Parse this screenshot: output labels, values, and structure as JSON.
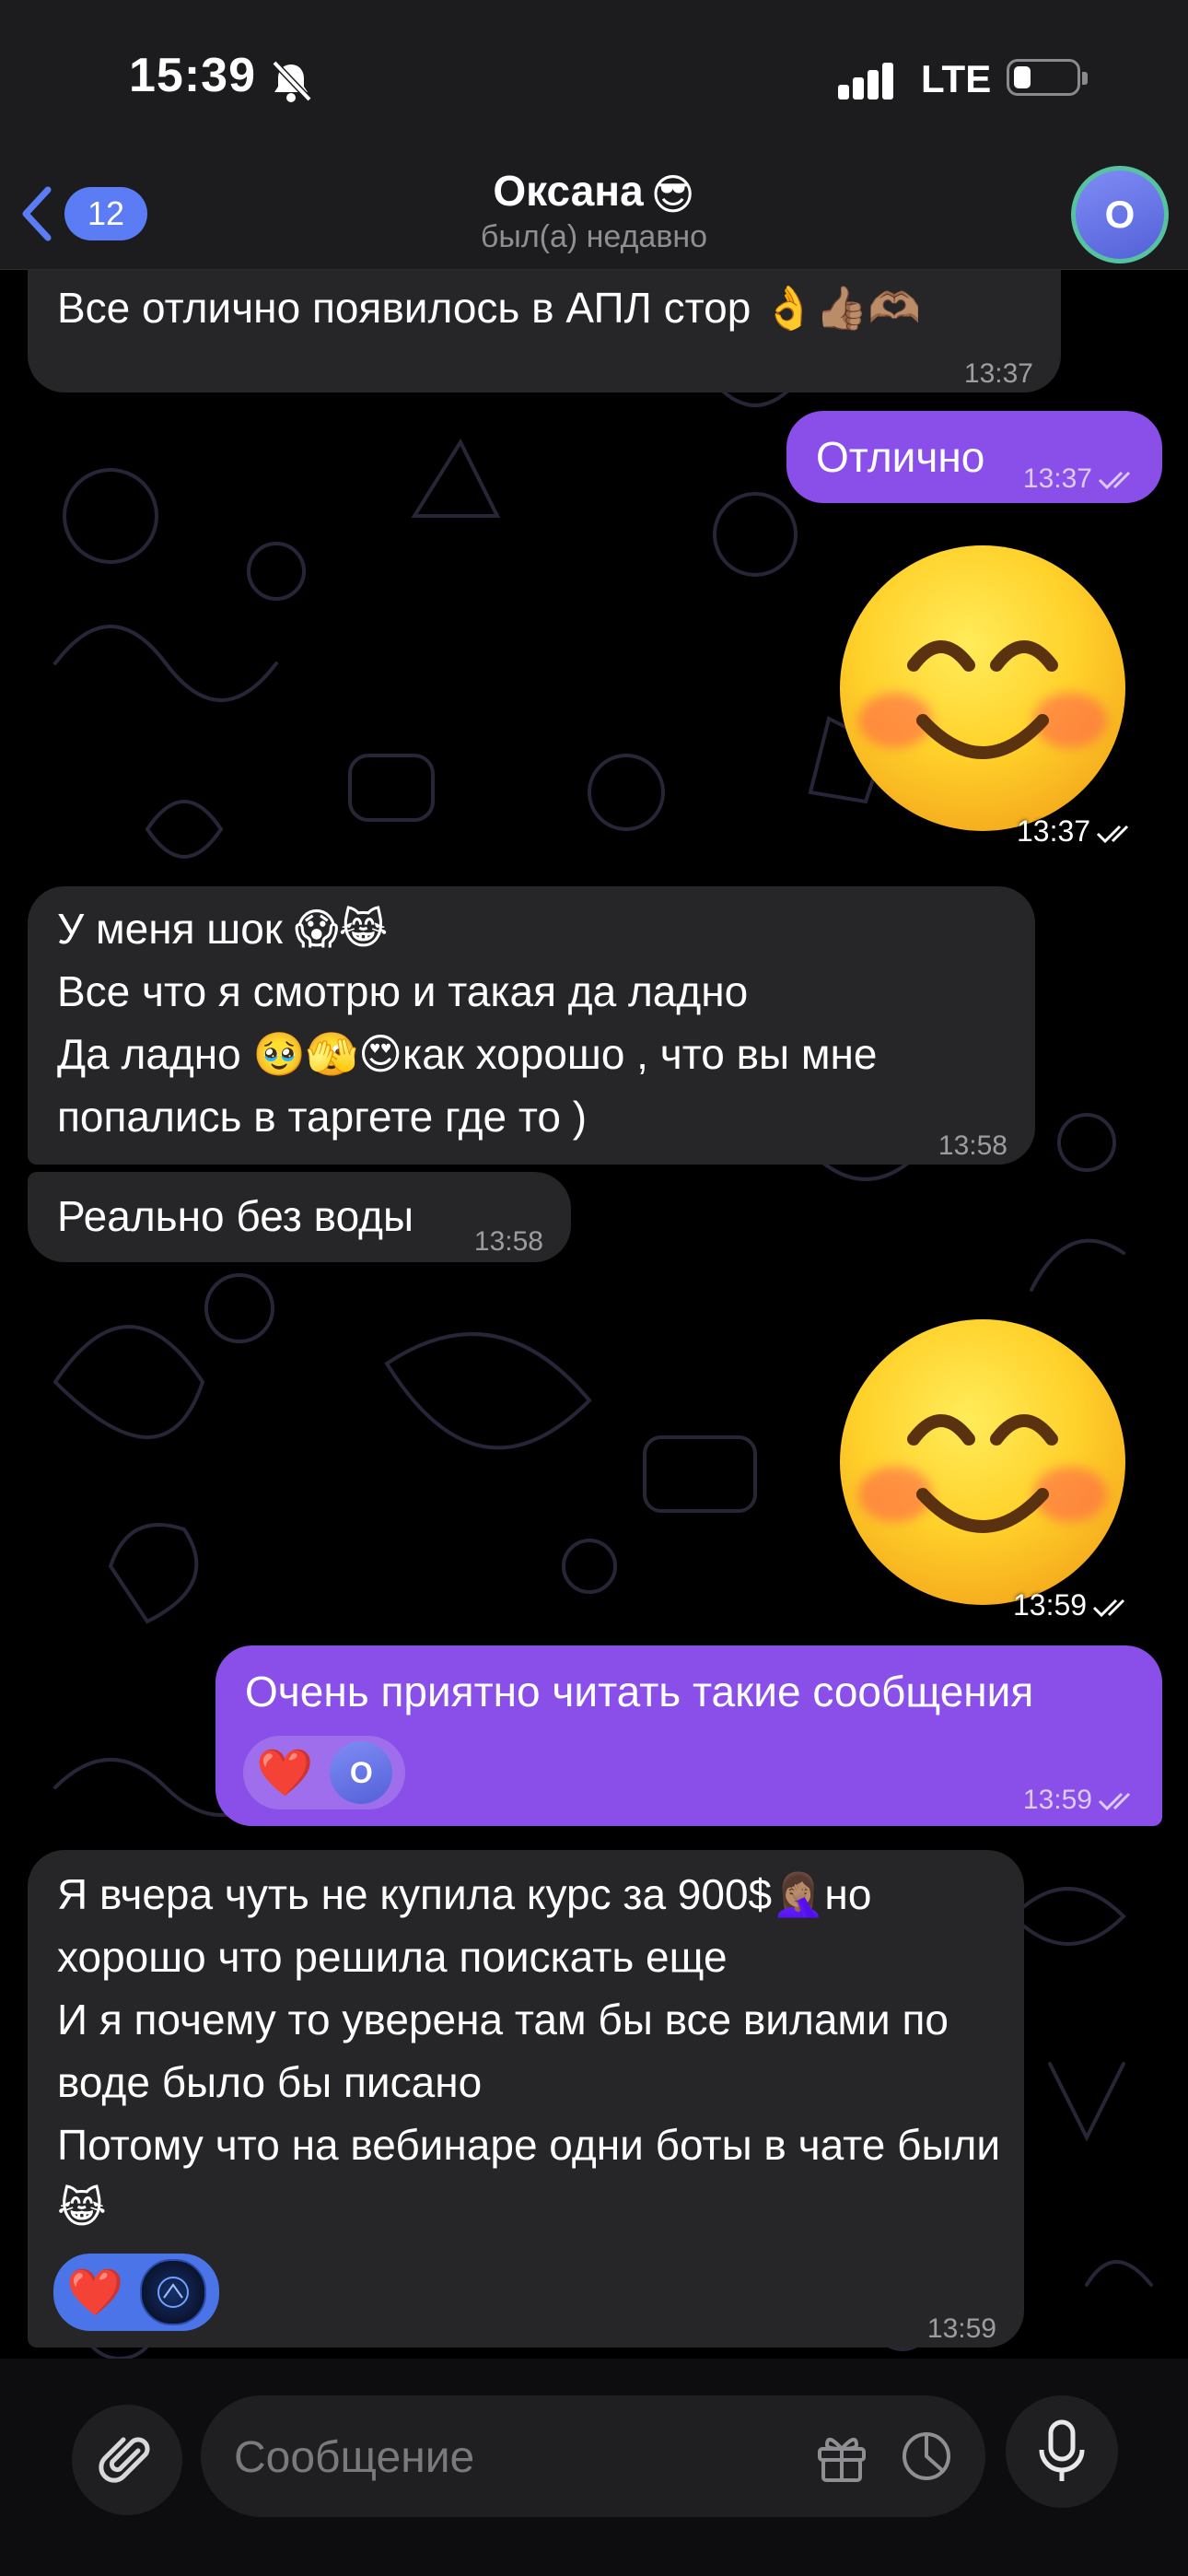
{
  "status_bar": {
    "time": "15:39",
    "network": "LTE"
  },
  "header": {
    "back_badge": "12",
    "contact_name": "Оксана",
    "contact_emoji": "😎",
    "contact_status": "был(а) недавно",
    "avatar_initial": "О"
  },
  "messages": [
    {
      "dir": "in",
      "text": "Все отлично появилось в АПЛ стор 👌👍🏽🫶🏽",
      "time": "13:37"
    },
    {
      "dir": "out",
      "text": "Отлично",
      "time": "13:37"
    },
    {
      "dir": "out",
      "kind": "sticker",
      "sticker": "smiling-face-sticker",
      "time": "13:37"
    },
    {
      "dir": "in",
      "text": "У меня шок 😱😹\nВсе что я смотрю и такая да ладно\nДа ладно 🥹🫣😍как хорошо , что вы мне попались в таргете где то )",
      "time": "13:58"
    },
    {
      "dir": "in",
      "text": "Реально без воды",
      "time": "13:58"
    },
    {
      "dir": "out",
      "kind": "sticker",
      "sticker": "smiling-face-sticker",
      "time": "13:59"
    },
    {
      "dir": "out",
      "text": "Очень приятно читать такие сообщения",
      "time": "13:59",
      "reaction": "❤️",
      "reaction_avatar": "О"
    },
    {
      "dir": "in",
      "text": "Я вчера чуть не купила курс за 900$🤦🏽‍♀️но хорошо что решила поискать еще\nИ я почему то уверена там бы все вилами по воде было бы писано\nПотому что на вебинаре одни боты в чате были 😹",
      "time": "13:59",
      "reaction": "❤️"
    }
  ],
  "composer": {
    "placeholder": "Сообщение"
  },
  "colors": {
    "outgoing": "#8a4fe8",
    "incoming": "#262628",
    "accent": "#5b7cf5"
  }
}
